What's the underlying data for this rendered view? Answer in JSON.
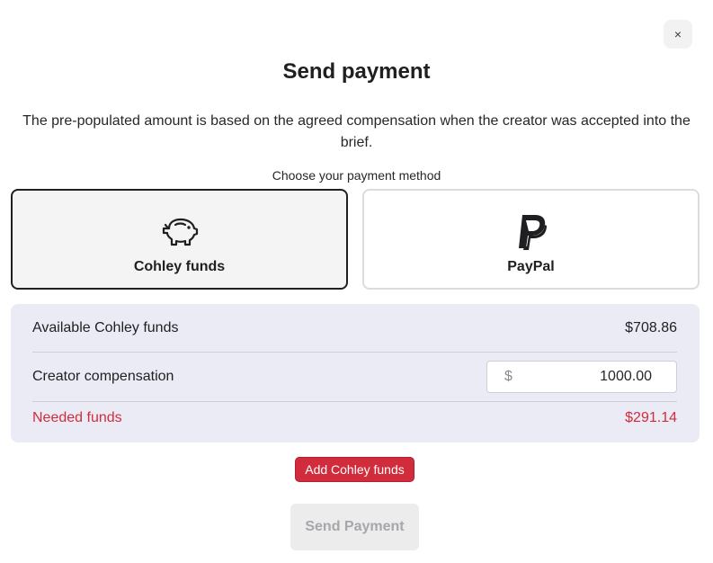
{
  "modal": {
    "close_label": "×",
    "title": "Send payment",
    "description": "The pre-populated amount is based on the agreed compensation when the creator was accepted into the brief.",
    "method_label": "Choose your payment method"
  },
  "payment_methods": [
    {
      "name": "Cohley funds",
      "icon": "piggy-bank-icon",
      "selected": true
    },
    {
      "name": "PayPal",
      "icon": "paypal-icon",
      "selected": false
    }
  ],
  "funds": {
    "available_label": "Available Cohley funds",
    "available_value": "$708.86",
    "compensation_label": "Creator compensation",
    "compensation_currency": "$",
    "compensation_value": "1000.00",
    "needed_label": "Needed funds",
    "needed_value": "$291.14"
  },
  "actions": {
    "add_funds_label": "Add Cohley funds",
    "send_label": "Send Payment"
  },
  "colors": {
    "accent_red": "#d12c3c",
    "panel_bg": "#ebebf6",
    "selected_border": "#202023"
  }
}
